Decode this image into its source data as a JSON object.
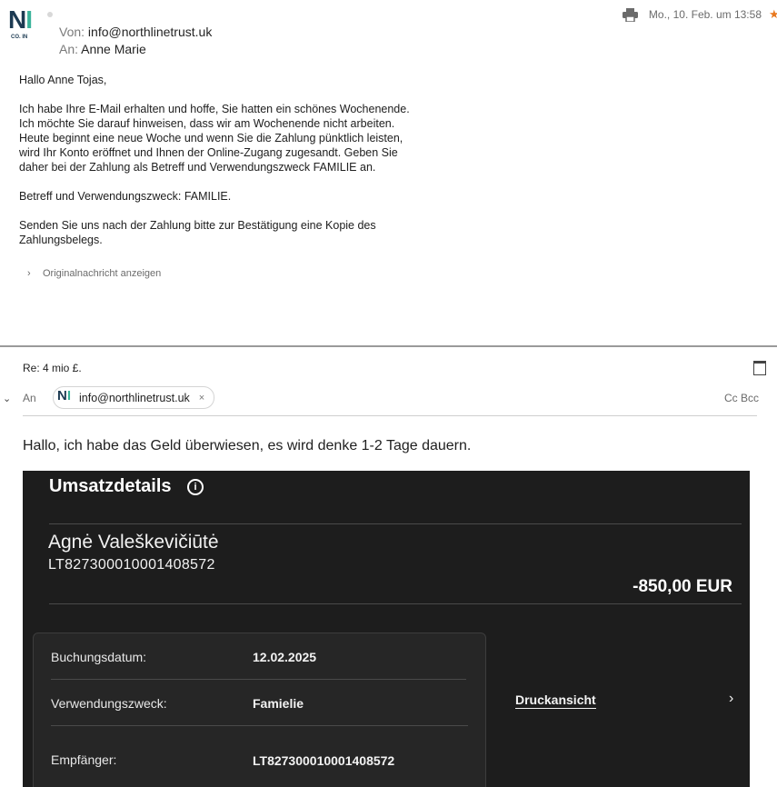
{
  "message": {
    "sender_logo": {
      "letters": "NI",
      "sub": "CO. IN"
    },
    "from_label": "Von:",
    "from_value": "info@northlinetrust.uk",
    "to_label": "An:",
    "to_value": "Anne Marie",
    "date": "Mo., 10. Feb. um 13:58",
    "greeting": "Hallo Anne Tojas,",
    "paragraph1": "Ich habe Ihre E-Mail erhalten und hoffe, Sie hatten ein schönes Wochenende. Ich möchte Sie darauf hinweisen, dass wir am Wochenende nicht arbeiten. Heute beginnt eine neue Woche und wenn Sie die Zahlung pünktlich leisten, wird Ihr Konto eröffnet und Ihnen der Online-Zugang zugesandt. Geben Sie daher bei der Zahlung als Betreff und Verwendungszweck FAMILIE an.",
    "paragraph2": "Betreff und Verwendungszweck: FAMILIE.",
    "paragraph3": "Senden Sie uns nach der Zahlung bitte zur Bestätigung eine Kopie des Zahlungsbelegs.",
    "show_original": "Originalnachricht anzeigen"
  },
  "compose": {
    "subject": "Re: 4 mio £.",
    "to_label": "An",
    "recipient": "info@northlinetrust.uk",
    "remove_glyph": "×",
    "cc_bcc": "Cc Bcc",
    "body": "Hallo, ich habe das Geld überwiesen, es wird denke 1-2 Tage dauern."
  },
  "bank_screenshot": {
    "title": "Umsatzdetails",
    "info_glyph": "i",
    "payee_name": "Agnė Valeškevičiūtė",
    "payee_iban": "LT827300010001408572",
    "amount": "-850,00 EUR",
    "rows": [
      {
        "label": "Buchungsdatum:",
        "value": "12.02.2025"
      },
      {
        "label": "Verwendungszweck:",
        "value": "Famielie"
      },
      {
        "label": "Empfänger:",
        "value": "LT827300010001408572"
      }
    ],
    "print_view": "Druckansicht"
  },
  "colors": {
    "accent_star": "#e8781e",
    "bank_bg": "#1d1d1d",
    "logo_navy": "#1c3a52",
    "logo_teal": "#3bb39a"
  }
}
